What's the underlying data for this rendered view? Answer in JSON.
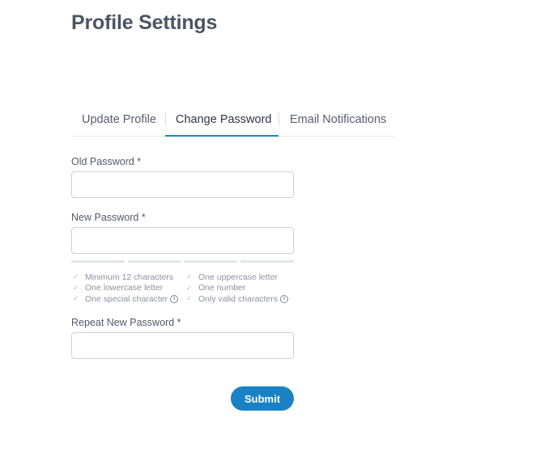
{
  "page": {
    "title": "Profile Settings"
  },
  "tabs": [
    {
      "label": "Update Profile",
      "active": false
    },
    {
      "label": "Change Password",
      "active": true
    },
    {
      "label": "Email Notifications",
      "active": false
    }
  ],
  "form": {
    "old_password": {
      "label": "Old Password *",
      "value": "",
      "placeholder": ""
    },
    "new_password": {
      "label": "New Password *",
      "value": "",
      "placeholder": ""
    },
    "repeat_password": {
      "label": "Repeat New Password *",
      "value": "",
      "placeholder": ""
    },
    "strength_level": 0,
    "requirements": [
      {
        "text": "Minimum 12 characters",
        "met": false,
        "info": false
      },
      {
        "text": "One uppercase letter",
        "met": false,
        "info": false
      },
      {
        "text": "One lowercase letter",
        "met": false,
        "info": false
      },
      {
        "text": "One number",
        "met": false,
        "info": false
      },
      {
        "text": "One special character",
        "met": false,
        "info": true
      },
      {
        "text": "Only valid characters",
        "met": false,
        "info": true
      }
    ],
    "submit_label": "Submit"
  },
  "colors": {
    "accent": "#1a82c4",
    "tab_underline": "#1f86c6",
    "requirement_text": "#8a939e"
  },
  "icons": {
    "check": "✓",
    "info": "i"
  }
}
